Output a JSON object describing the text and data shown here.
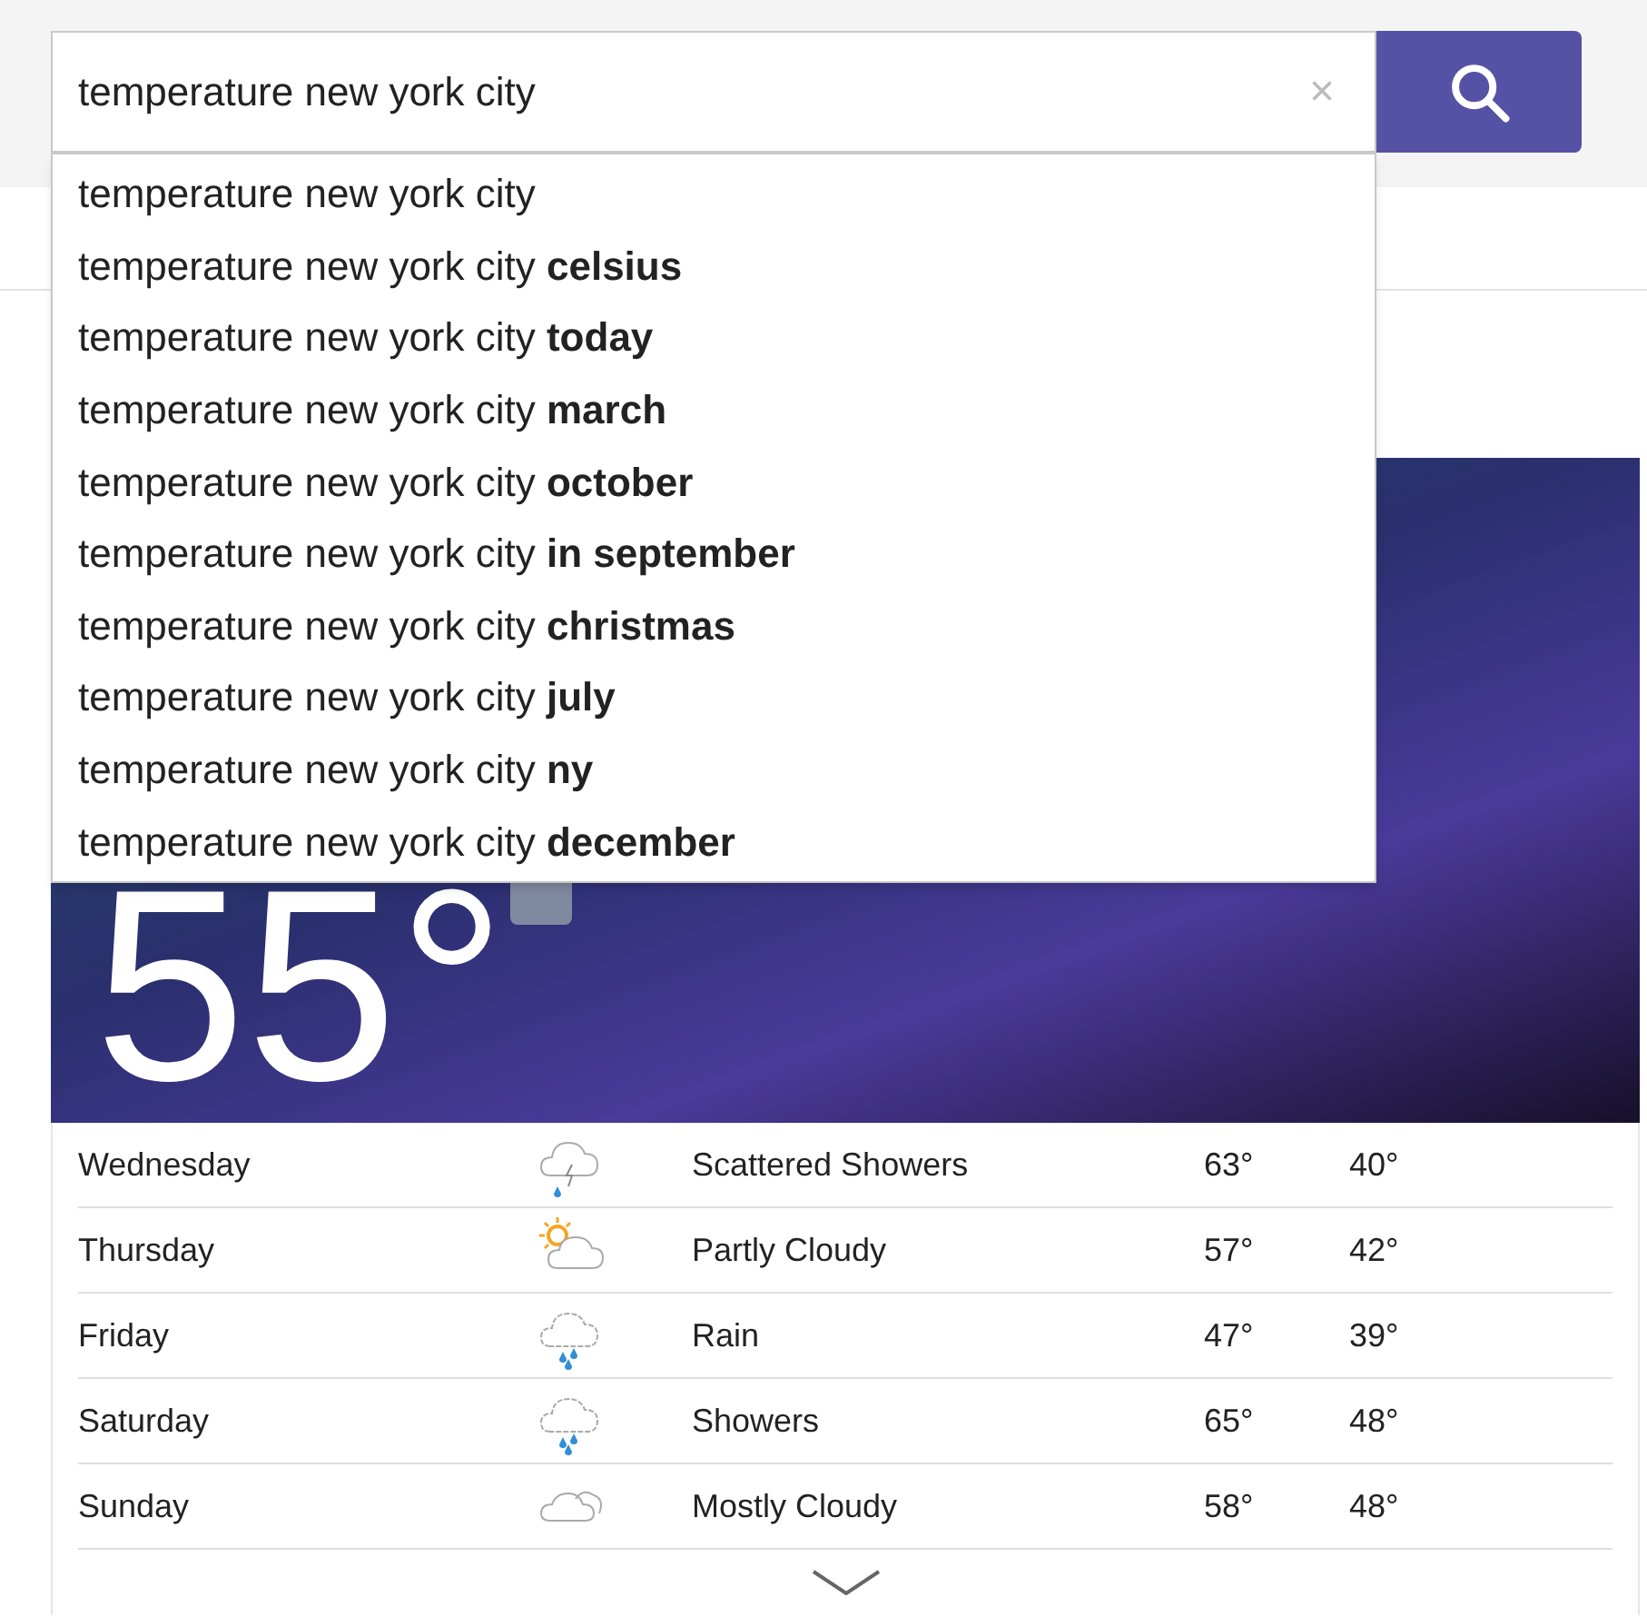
{
  "search": {
    "value": "temperature new york city",
    "clear": "×"
  },
  "suggestions": [
    "temperature new york city",
    "temperature new york city **celsius**",
    "temperature new york city **today**",
    "temperature new york city **march**",
    "temperature new york city **october**",
    "temperature new york city **in september**",
    "temperature new york city **christmas**",
    "temperature new york city **july**",
    "temperature new york city **ny**",
    "temperature new york city **december**"
  ],
  "current": {
    "temperature": "55°"
  },
  "forecast": [
    {
      "day": "Wednesday",
      "kind": "storm",
      "condition": "Scattered Showers",
      "high": "63°",
      "low": "40°"
    },
    {
      "day": "Thursday",
      "kind": "partly-cloudy",
      "condition": "Partly Cloudy",
      "high": "57°",
      "low": "42°"
    },
    {
      "day": "Friday",
      "kind": "rain",
      "condition": "Rain",
      "high": "47°",
      "low": "39°"
    },
    {
      "day": "Saturday",
      "kind": "rain",
      "condition": "Showers",
      "high": "65°",
      "low": "48°"
    },
    {
      "day": "Sunday",
      "kind": "cloudy",
      "condition": "Mostly Cloudy",
      "high": "58°",
      "low": "48°"
    }
  ]
}
